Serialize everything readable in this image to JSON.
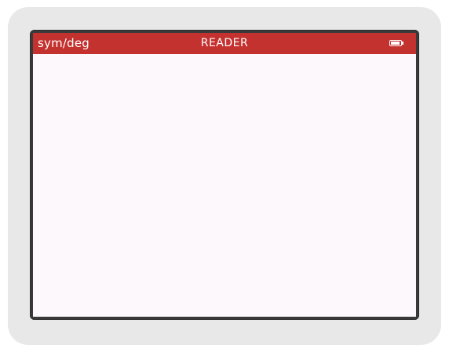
{
  "status_bar": {
    "mode": "sym/deg",
    "title": "READER",
    "battery_level": 1.0,
    "battery_icon": "battery-full-icon"
  },
  "colors": {
    "status_bar": "#c43230",
    "screen_background": "#fdf8fb",
    "device_body": "#e8e8e8",
    "bezel": "#3a3a3a"
  }
}
